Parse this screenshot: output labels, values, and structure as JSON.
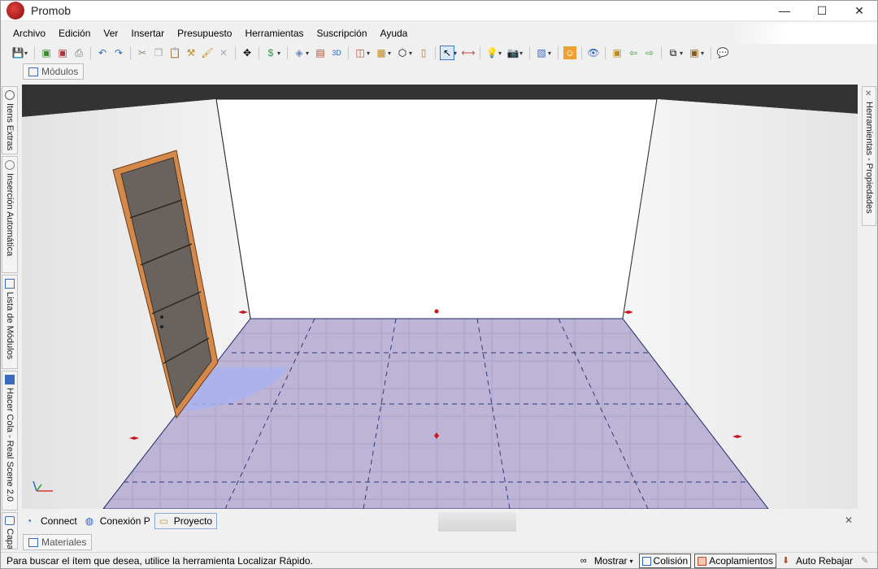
{
  "window": {
    "title": "Promob"
  },
  "window_controls": {
    "minimize": "—",
    "maximize": "☐",
    "close": "✕"
  },
  "menu": [
    "Archivo",
    "Edición",
    "Ver",
    "Insertar",
    "Presupuesto",
    "Herramientas",
    "Suscripción",
    "Ayuda"
  ],
  "toolbar": {
    "icons": [
      "save-icon",
      "export-icon",
      "print-preview-icon",
      "print-icon",
      "undo-icon",
      "redo-icon",
      "cut-icon",
      "copy-icon",
      "paste-icon",
      "hammer-icon",
      "paint-icon",
      "delete-icon",
      "move-icon",
      "price-icon",
      "layers-icon",
      "dimension-icon",
      "3d-icon",
      "wall-icon",
      "brick-icon",
      "shape-icon",
      "door-icon",
      "select-icon",
      "measure-icon",
      "light-icon",
      "camera-icon",
      "palette-icon",
      "user-icon",
      "eye-icon",
      "render-icon",
      "arrow-left-icon",
      "arrow-right-icon",
      "view-icon",
      "box-icon",
      "chat-icon"
    ]
  },
  "panels": {
    "top_tab": "Módulos",
    "left_tabs": [
      "Itens Extras",
      "Inserción Automática",
      "Lista de Módulos",
      "Hacer Cola - Real Scene 2.0",
      "Capas"
    ],
    "right_tab": "Herramientas - Propiedades",
    "bottom_tabs": [
      "Connect",
      "Conexión P",
      "Proyecto"
    ],
    "bottom_active": "Proyecto",
    "materials_tab": "Materiales"
  },
  "status": {
    "message": "Para buscar el ítem que desea, utilice la herramienta Localizar Rápido.",
    "mostrar": "Mostrar",
    "colision": "Colisión",
    "acoplamientos": "Acoplamientos",
    "auto_rebajar": "Auto Rebajar"
  },
  "colors": {
    "floor": "#b5acd0",
    "floor_grid": "#2c3c7a",
    "door_frame": "#d4894a",
    "door_panel": "#6a625c",
    "swing_area": "#a9b2ee",
    "wall": "#ffffff",
    "ceiling": "#333333",
    "marker": "#c8141e"
  }
}
